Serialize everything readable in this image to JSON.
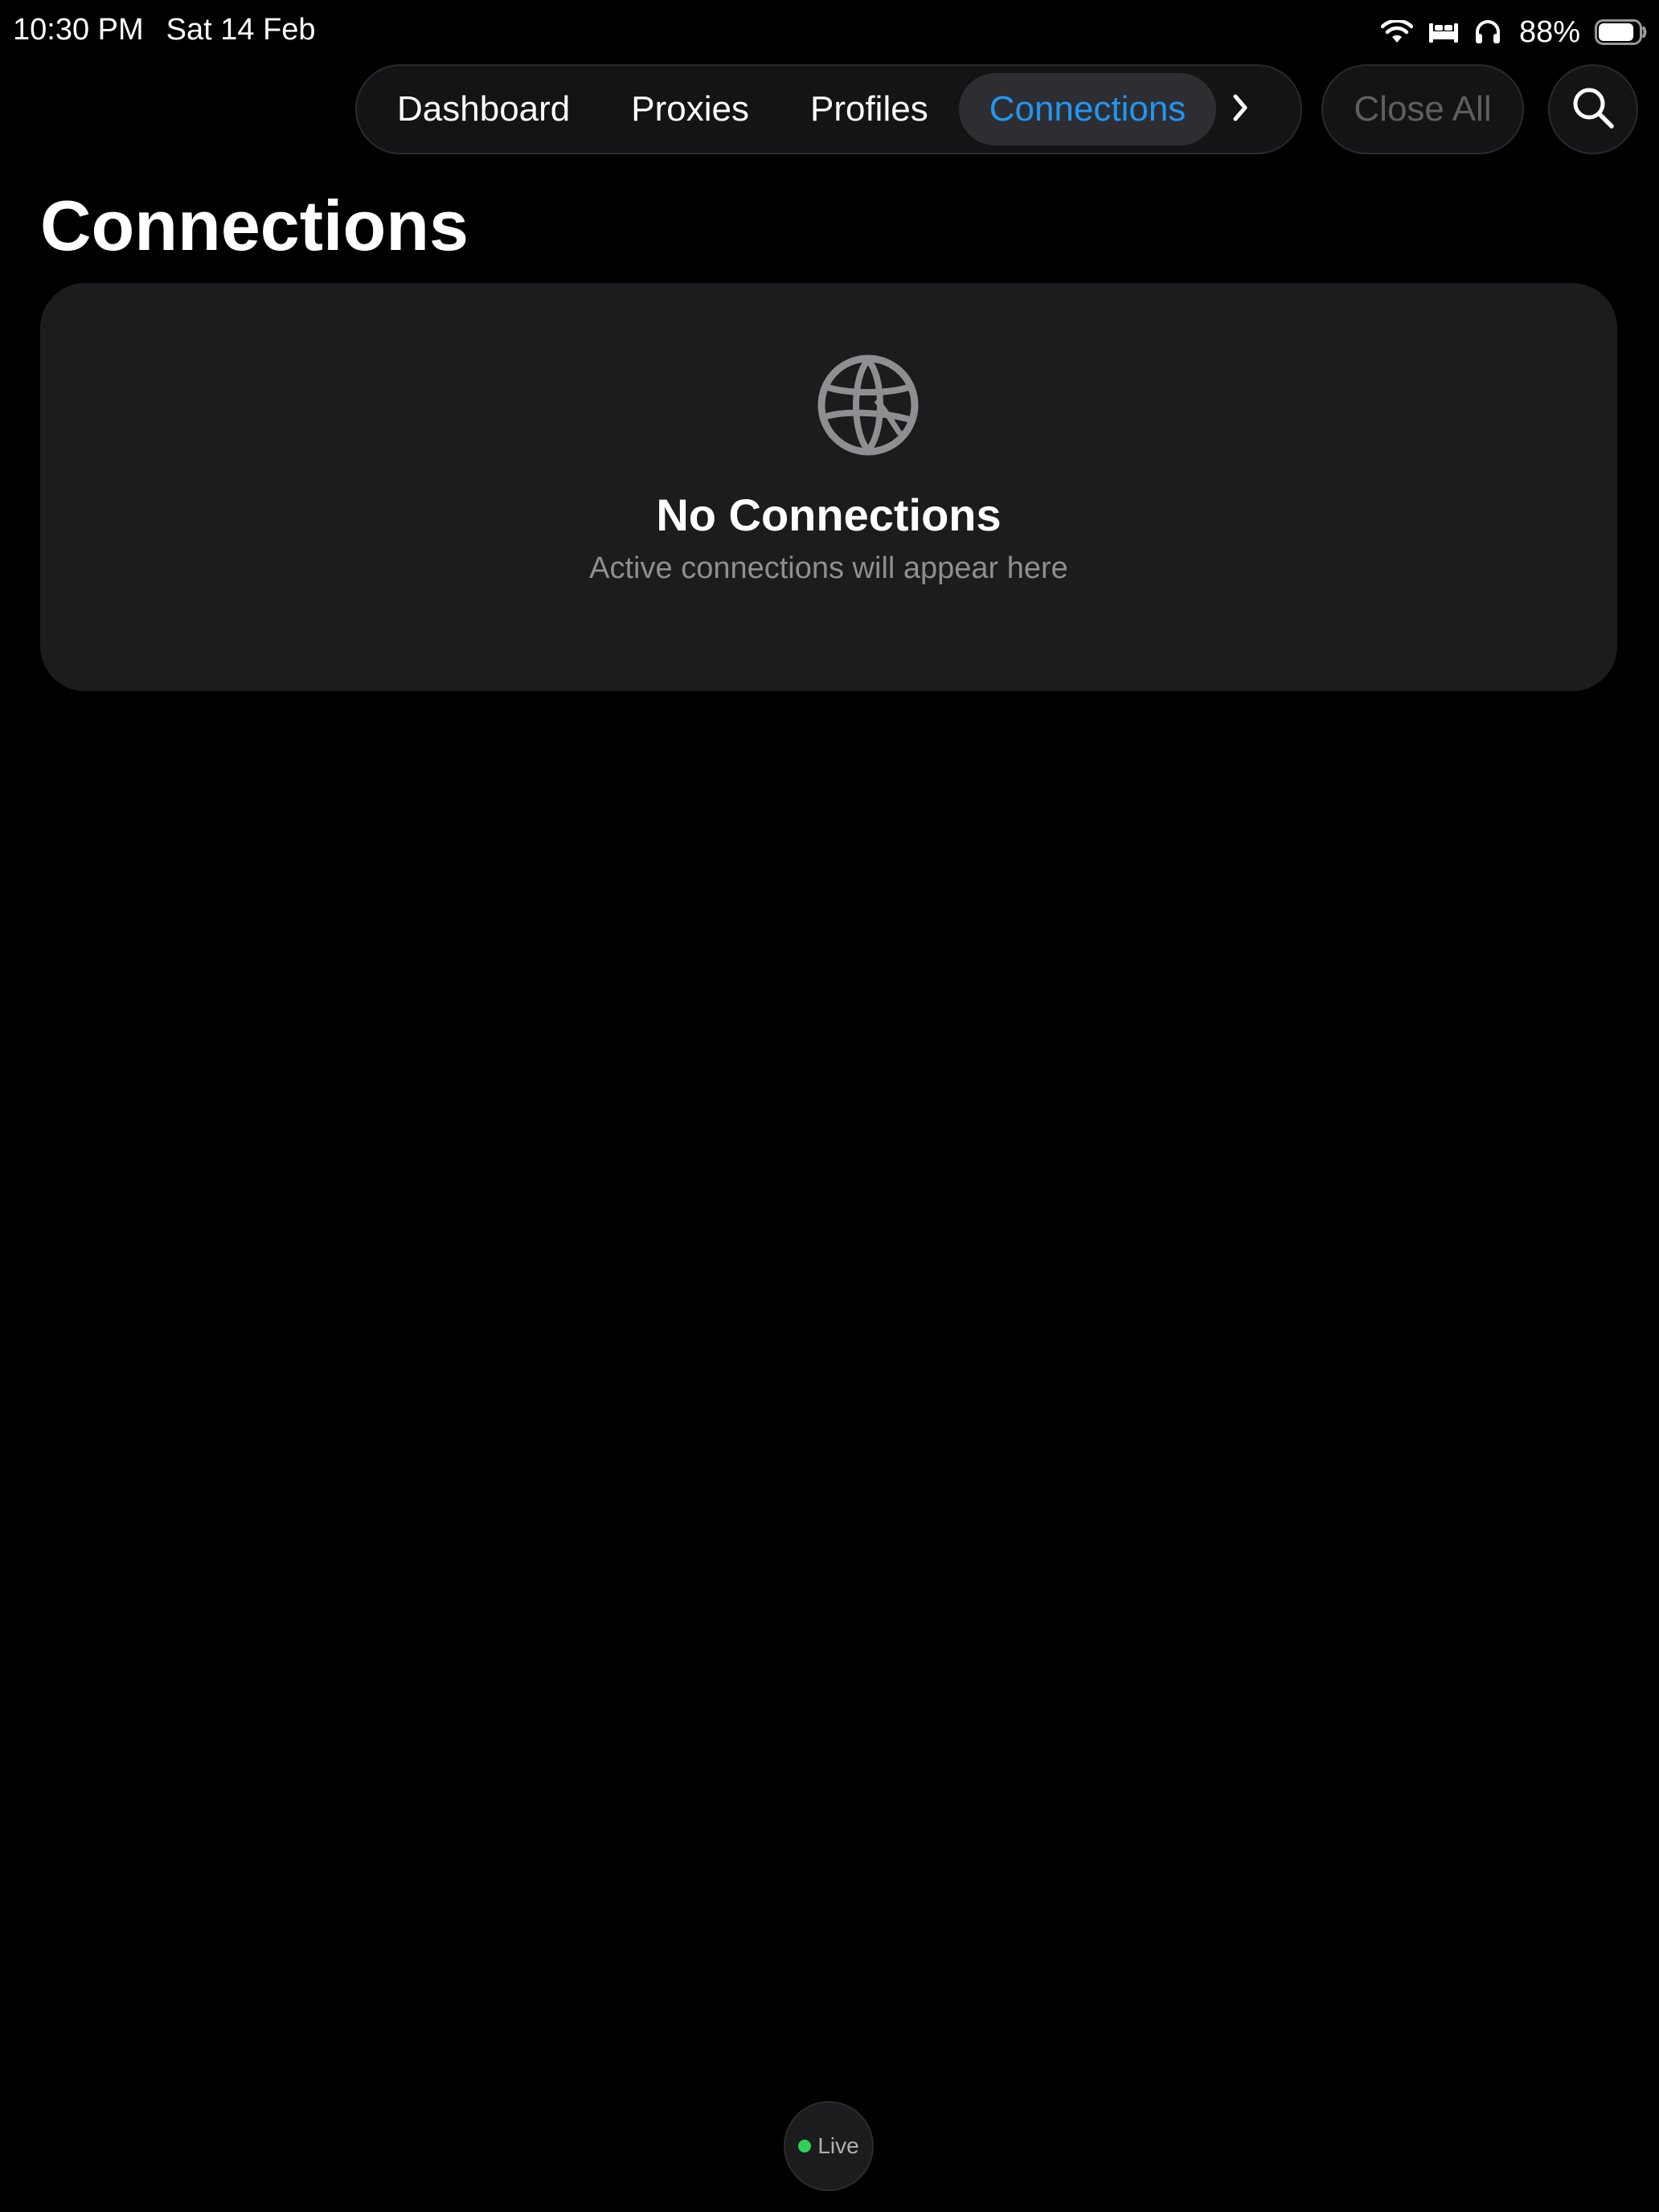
{
  "status_bar": {
    "time": "10:30 PM",
    "date": "Sat 14 Feb",
    "battery_percent": "88%",
    "battery_level": 0.88,
    "icons": [
      "wifi-icon",
      "bed-icon",
      "headphones-icon",
      "battery-icon"
    ]
  },
  "nav": {
    "tabs": [
      {
        "label": "Dashboard",
        "active": false
      },
      {
        "label": "Proxies",
        "active": false
      },
      {
        "label": "Profiles",
        "active": false
      },
      {
        "label": "Connections",
        "active": true
      }
    ],
    "more_icon": "chevron-right-icon",
    "close_all_label": "Close All",
    "search_icon": "search-icon"
  },
  "page": {
    "title": "Connections"
  },
  "empty_state": {
    "icon": "globe-icon",
    "title": "No Connections",
    "subtitle": "Active connections will appear here"
  },
  "live_indicator": {
    "label": "Live",
    "dot_color": "#30d158"
  },
  "colors": {
    "accent": "#2196f3",
    "background": "#000000",
    "card": "#1c1c1e",
    "secondary_text": "#8e8e93",
    "disabled_text": "#5f5f63"
  }
}
